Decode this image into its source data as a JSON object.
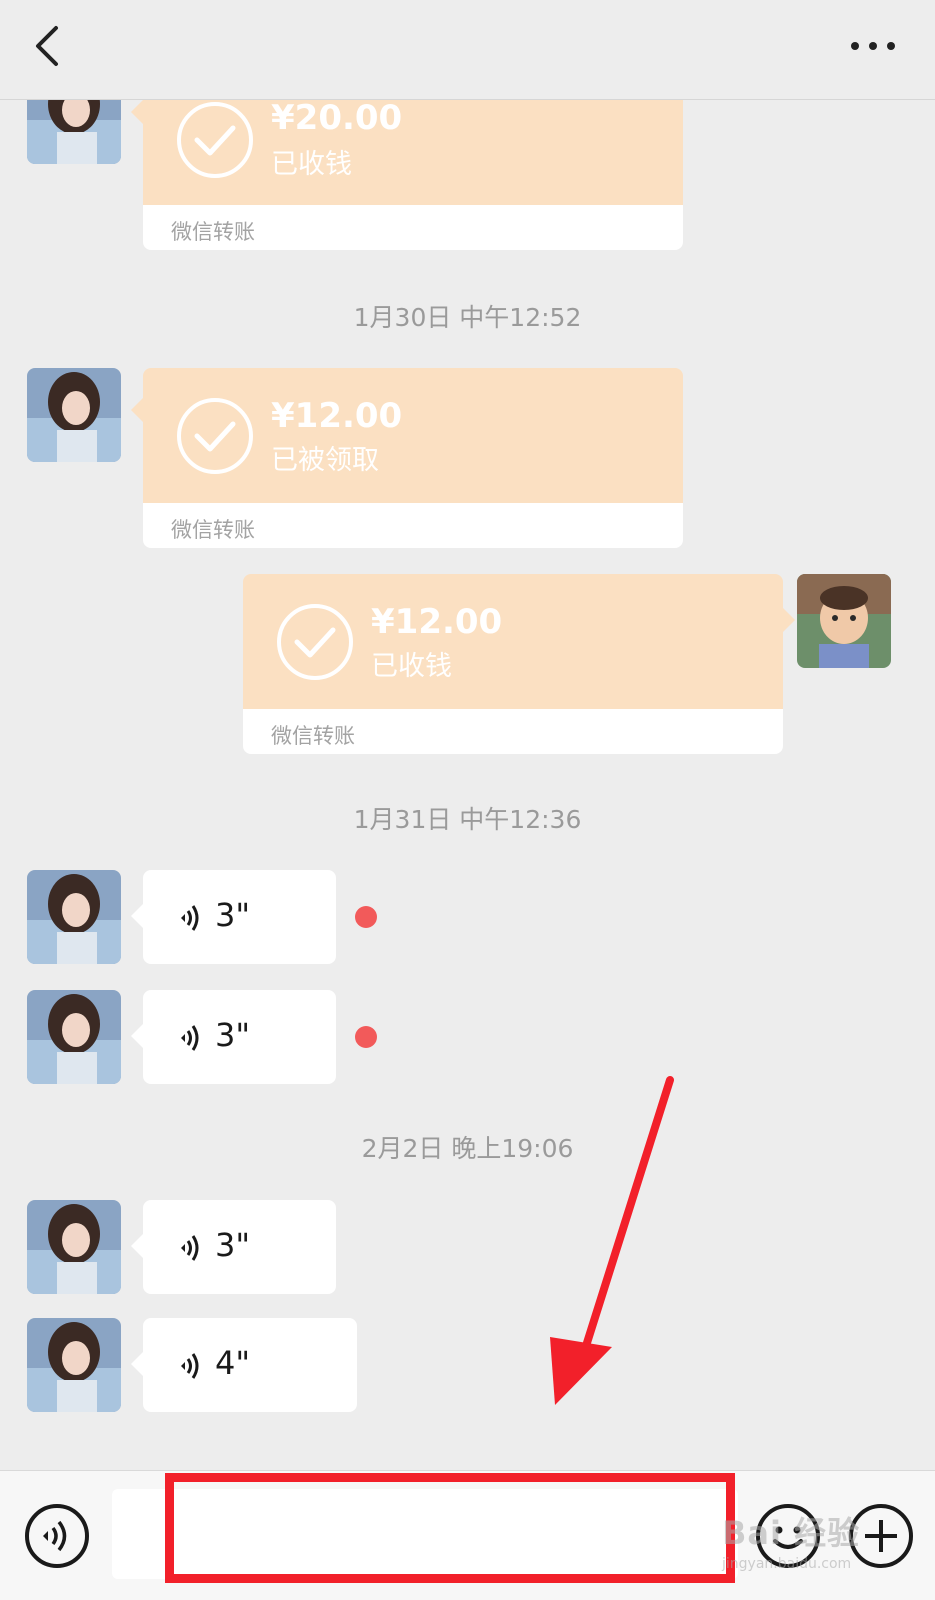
{
  "header": {
    "back_icon": "chevron-left-icon",
    "more_icon": "more-dots-icon"
  },
  "colors": {
    "background": "#ededed",
    "transfer_orange": "#fbe0c2",
    "unread_dot": "#f25a5a",
    "annotation_red": "#f2202a"
  },
  "messages": {
    "transfer1": {
      "amount": "¥20.00",
      "status": "已收钱",
      "label": "微信转账"
    },
    "time1": "1月30日 中午12:52",
    "transfer2": {
      "amount": "¥12.00",
      "status": "已被领取",
      "label": "微信转账"
    },
    "transfer3": {
      "amount": "¥12.00",
      "status": "已收钱",
      "label": "微信转账"
    },
    "time2": "1月31日 中午12:36",
    "voice1": {
      "duration": "3\"",
      "unread": true
    },
    "voice2": {
      "duration": "3\"",
      "unread": true
    },
    "time3": "2月2日 晚上19:06",
    "voice3": {
      "duration": "3\""
    },
    "voice4": {
      "duration": "4\""
    }
  },
  "input_bar": {
    "voice_icon": "voice-toggle-icon",
    "input_value": "",
    "emoji_icon": "emoji-icon",
    "plus_icon": "plus-icon"
  },
  "watermark": {
    "main": "Bai 经验",
    "sub": "jingyan.baidu.com"
  }
}
